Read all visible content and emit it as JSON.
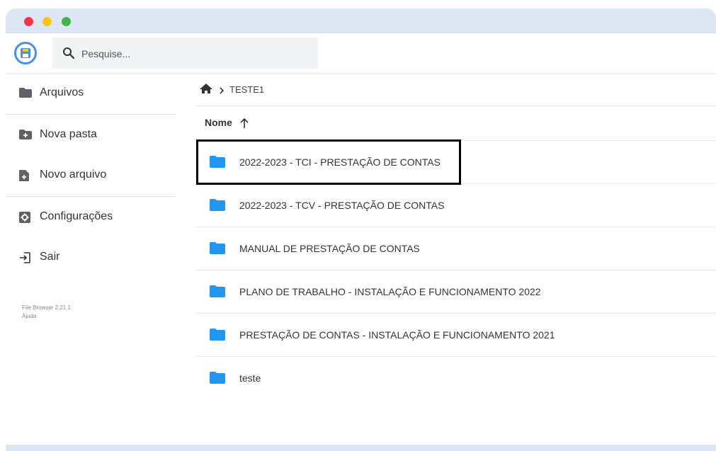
{
  "header": {
    "search_placeholder": "Pesquise..."
  },
  "sidebar": {
    "items": [
      {
        "label": "Arquivos",
        "icon": "folder-icon"
      },
      {
        "label": "Nova pasta",
        "icon": "new-folder-icon"
      },
      {
        "label": "Novo arquivo",
        "icon": "new-file-icon"
      },
      {
        "label": "Configurações",
        "icon": "settings-icon"
      },
      {
        "label": "Sair",
        "icon": "logout-icon"
      }
    ],
    "version": "File Browser 2.21.1",
    "help": "Ajuda"
  },
  "breadcrumb": {
    "current": "TESTE1"
  },
  "listing": {
    "column_name": "Nome",
    "rows": [
      "2022-2023 - TCI - PRESTAÇÃO DE CONTAS",
      "2022-2023 - TCV - PRESTAÇÃO DE CONTAS",
      "MANUAL DE PRESTAÇÃO DE CONTAS",
      "PLANO DE TRABALHO - INSTALAÇÃO E FUNCIONAMENTO 2022",
      "PRESTAÇÃO DE CONTAS - INSTALAÇÃO E FUNCIONAMENTO 2021",
      "teste"
    ]
  },
  "colors": {
    "accent": "#2196f3",
    "titlebar": "#dde7f3",
    "sidebar_icon": "#5f6368"
  }
}
